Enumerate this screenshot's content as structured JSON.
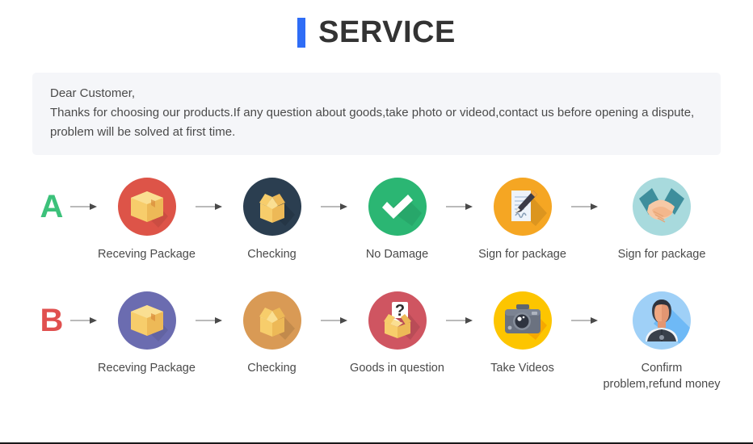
{
  "header": {
    "title": "SERVICE",
    "accent_color": "#2f6df6"
  },
  "notice": {
    "lines": [
      "Dear Customer,",
      "Thanks for choosing our products.If any question about goods,take photo or videod,contact us before opening a dispute,",
      "problem will be solved at first time."
    ]
  },
  "rows": [
    {
      "letter": "A",
      "letter_color": "#3cc17a",
      "steps": [
        {
          "label": "Receving Package",
          "icon": "package-box-icon",
          "circle_color": "#dd5448"
        },
        {
          "label": "Checking",
          "icon": "open-box-icon",
          "circle_color": "#2b3e50"
        },
        {
          "label": "No Damage",
          "icon": "check-mark-icon",
          "circle_color": "#2bb673"
        },
        {
          "label": "Sign for package",
          "icon": "sign-document-icon",
          "circle_color": "#f5a623"
        },
        {
          "label": "Sign for package",
          "icon": "handshake-icon",
          "circle_color": "#a8dadd"
        }
      ]
    },
    {
      "letter": "B",
      "letter_color": "#e0504f",
      "steps": [
        {
          "label": "Receving Package",
          "icon": "package-box-icon",
          "circle_color": "#6b6cb0"
        },
        {
          "label": "Checking",
          "icon": "open-box-icon",
          "circle_color": "#d99a55"
        },
        {
          "label": "Goods in question",
          "icon": "question-box-icon",
          "circle_color": "#cf5561"
        },
        {
          "label": "Take Videos",
          "icon": "camera-icon",
          "circle_color": "#fdc500"
        },
        {
          "label": "Confirm problem,refund money",
          "icon": "support-agent-icon",
          "circle_color": "#9fd0f7"
        }
      ]
    }
  ],
  "arrow": {
    "icon": "arrow-right-icon",
    "color": "#4a4a4a"
  }
}
